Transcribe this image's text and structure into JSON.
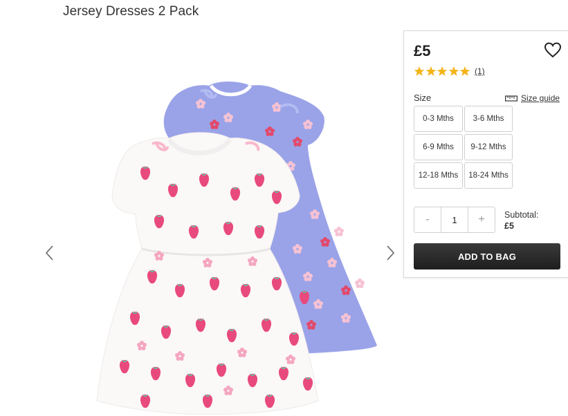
{
  "page": {
    "title": "Jersey Dresses 2 Pack"
  },
  "product": {
    "price": "£5",
    "rating": {
      "stars": 5,
      "count_label": "(1)"
    },
    "size_label": "Size",
    "size_guide_label": "Size guide",
    "sizes": [
      "0-3 Mths",
      "3-6 Mths",
      "6-9 Mths",
      "9-12 Mths",
      "12-18 Mths",
      "18-24 Mths"
    ],
    "quantity": {
      "minus": "-",
      "value": "1",
      "plus": "+"
    },
    "subtotal_label": "Subtotal:",
    "subtotal_value": "£5",
    "add_to_bag_label": "ADD TO BAG"
  },
  "icons": {
    "wishlist": "heart-outline-icon",
    "star": "star-icon",
    "size_guide": "ruler-icon",
    "prev": "chevron-left-icon",
    "next": "chevron-right-icon"
  },
  "colors": {
    "star": "#f3b51a",
    "button_dark": "#2a2a2a",
    "lilac_dress": "#9ea6e6",
    "white_dress": "#fbf8f8",
    "strawberry": "#e84a7d"
  }
}
